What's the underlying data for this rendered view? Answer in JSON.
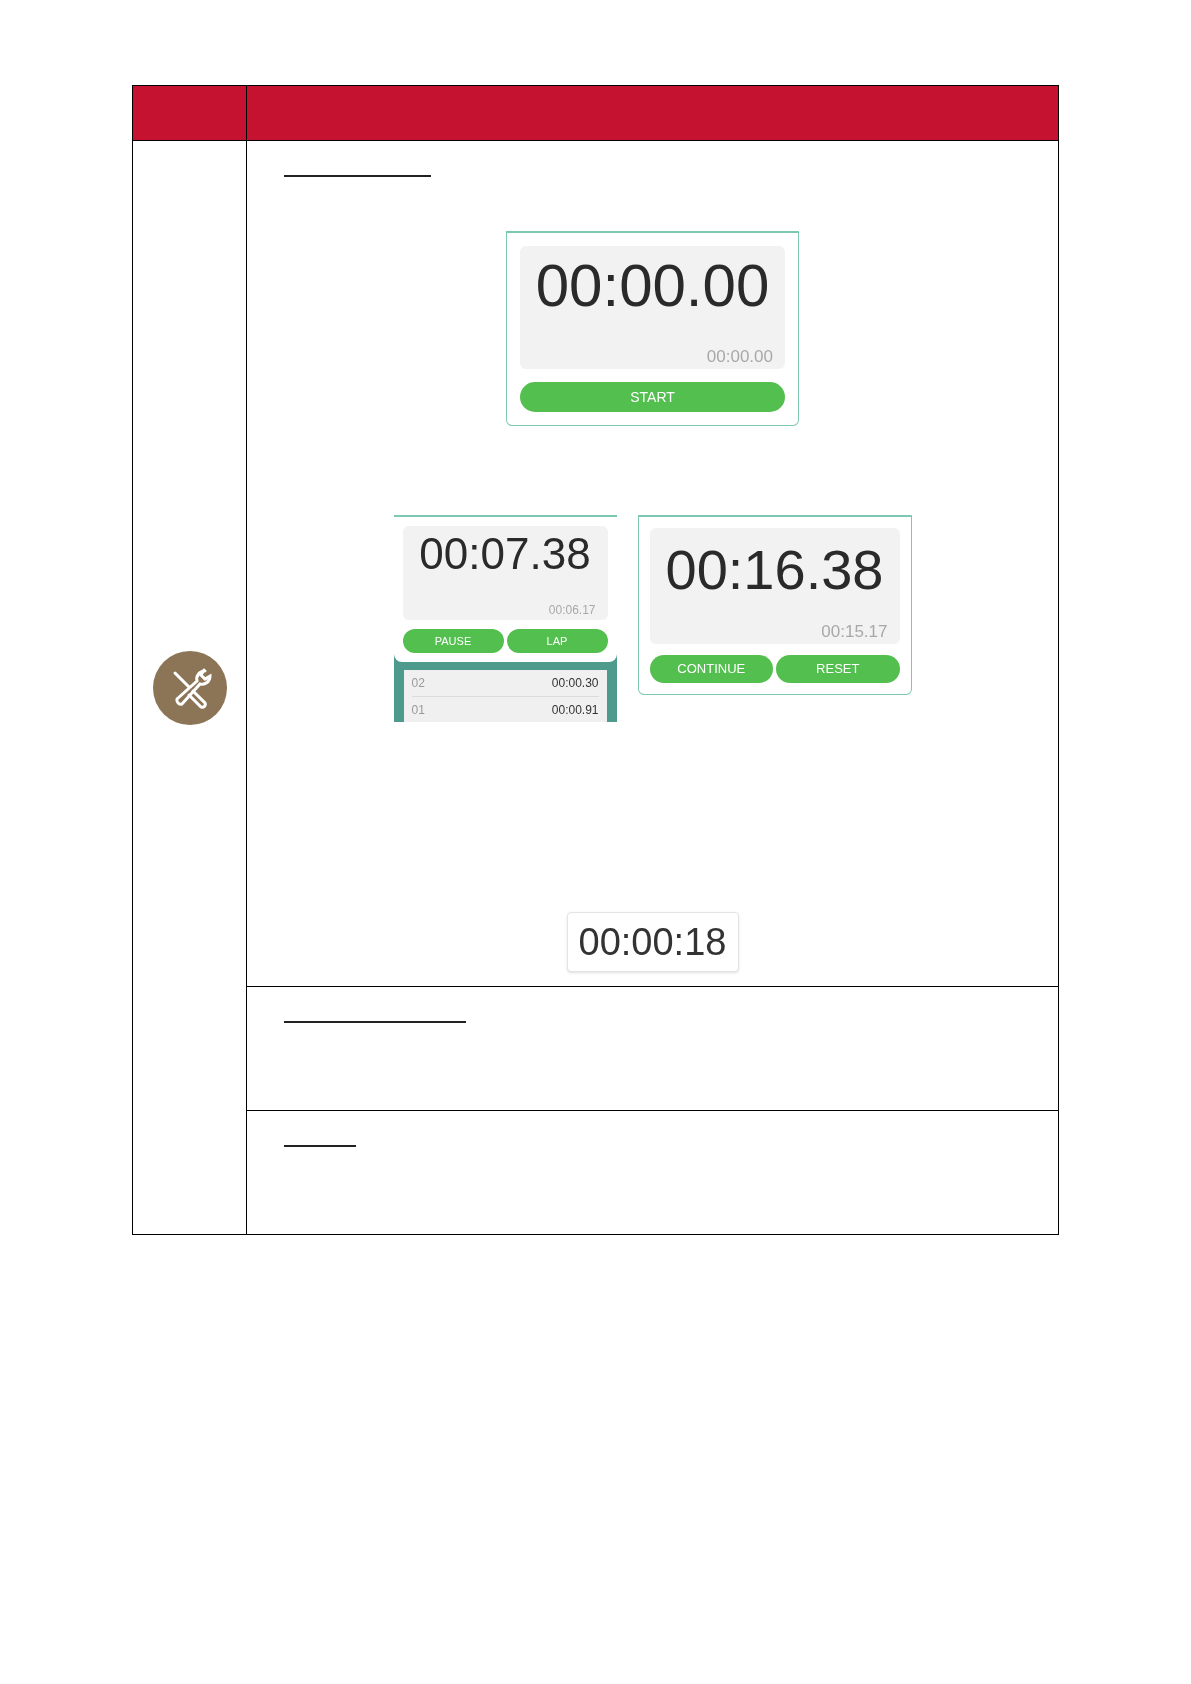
{
  "stopwatches": [
    {
      "kind": "idle",
      "main": "00:00.00",
      "sub": "00:00.00",
      "buttons": [
        "START"
      ]
    },
    {
      "kind": "running",
      "main": "00:07.38",
      "sub": "00:06.17",
      "buttons": [
        "PAUSE",
        "LAP"
      ],
      "laps": [
        {
          "index": "02",
          "time": "00:00.30"
        },
        {
          "index": "01",
          "time": "00:00.91"
        }
      ]
    },
    {
      "kind": "paused",
      "main": "00:16.38",
      "sub": "00:15.17",
      "buttons": [
        "CONTINUE",
        "RESET"
      ]
    }
  ],
  "clock_display": "00:00:18"
}
